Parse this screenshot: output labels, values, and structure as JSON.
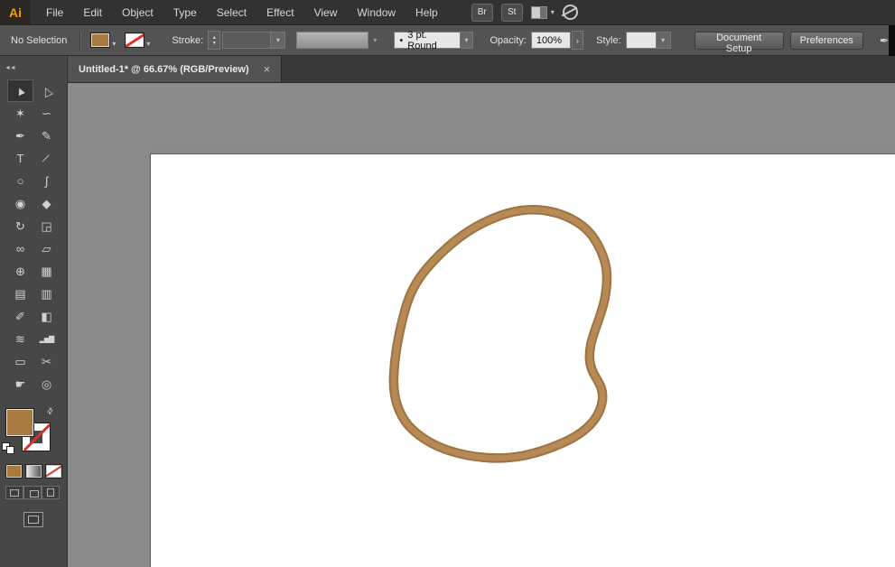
{
  "icons": {
    "caret_down": "▾",
    "step_up": "▴",
    "step_down": "▾",
    "chevron_right": "›",
    "swap_arrows": "⇄",
    "collapse_left": "◄◄",
    "bullet": "•",
    "pen_nib": "✒"
  },
  "menubar": {
    "logo": "Ai",
    "items": [
      "File",
      "Edit",
      "Object",
      "Type",
      "Select",
      "Effect",
      "View",
      "Window",
      "Help"
    ],
    "br_button": "Br",
    "st_button": "St"
  },
  "controlbar": {
    "selection_status": "No Selection",
    "stroke_label": "Stroke:",
    "brush_profile": "3 pt. Round",
    "opacity_label": "Opacity:",
    "opacity_value": "100%",
    "style_label": "Style:",
    "document_setup_button": "Document Setup",
    "preferences_button": "Preferences"
  },
  "tabbar": {
    "document_tab": "Untitled-1* @ 66.67% (RGB/Preview)",
    "close_icon": "×"
  },
  "toolpanel": {
    "tools": [
      {
        "name": "selection-tool",
        "glyph": "▲"
      },
      {
        "name": "direct-selection-tool",
        "glyph": "△"
      },
      {
        "name": "magic-wand-tool",
        "glyph": "✶"
      },
      {
        "name": "lasso-tool",
        "glyph": "∽"
      },
      {
        "name": "pen-tool",
        "glyph": "✒"
      },
      {
        "name": "pencil-tool",
        "glyph": "✎"
      },
      {
        "name": "type-tool",
        "glyph": "T"
      },
      {
        "name": "line-segment-tool",
        "glyph": "∕"
      },
      {
        "name": "ellipse-tool",
        "glyph": "○"
      },
      {
        "name": "paintbrush-tool",
        "glyph": "∫"
      },
      {
        "name": "blob-brush-tool",
        "glyph": "◉"
      },
      {
        "name": "eraser-tool",
        "glyph": "◆"
      },
      {
        "name": "rotate-tool",
        "glyph": "↻"
      },
      {
        "name": "scale-tool",
        "glyph": "◲"
      },
      {
        "name": "width-tool",
        "glyph": "∞"
      },
      {
        "name": "free-transform-tool",
        "glyph": "▱"
      },
      {
        "name": "shape-builder-tool",
        "glyph": "⊕"
      },
      {
        "name": "perspective-grid-tool",
        "glyph": "▦"
      },
      {
        "name": "mesh-tool",
        "glyph": "▤"
      },
      {
        "name": "gradient-tool",
        "glyph": "▥"
      },
      {
        "name": "eyedropper-tool",
        "glyph": "✐"
      },
      {
        "name": "blend-tool",
        "glyph": "◧"
      },
      {
        "name": "symbol-sprayer-tool",
        "glyph": "≋"
      },
      {
        "name": "column-graph-tool",
        "glyph": "▂▅▇"
      },
      {
        "name": "artboard-tool",
        "glyph": "▭"
      },
      {
        "name": "slice-tool",
        "glyph": "✂"
      },
      {
        "name": "hand-tool",
        "glyph": "☛"
      },
      {
        "name": "zoom-tool",
        "glyph": "◎"
      }
    ]
  },
  "colors": {
    "fill_brown": "#a87a3f",
    "shape_stroke_outer": "#9c7342",
    "shape_stroke_inner": "#b78a55",
    "none_red": "#d9342b",
    "canvas_gray": "#8b8b8b",
    "artboard_white": "#ffffff"
  }
}
